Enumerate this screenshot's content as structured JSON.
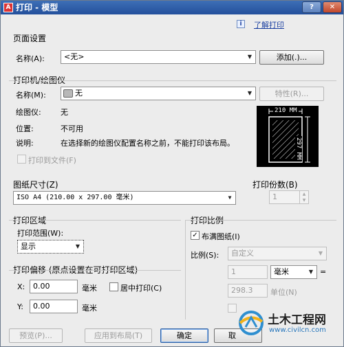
{
  "window": {
    "title": "打印 - 模型"
  },
  "help": {
    "link": "了解打印",
    "icon": "info-icon"
  },
  "page_setup": {
    "group": "页面设置",
    "name_label": "名称(A):",
    "name_value": "<无>",
    "add_button": "添加(.)..."
  },
  "printer": {
    "group": "打印机/绘图仪",
    "name_label": "名称(M):",
    "name_value": "无",
    "properties_button": "特性(R)...",
    "plotter_label": "绘图仪:",
    "plotter_value": "无",
    "location_label": "位置:",
    "location_value": "不可用",
    "desc_label": "说明:",
    "desc_value": "在选择新的绘图仪配置名称之前，不能打印该布局。",
    "print_to_file": "打印到文件(F)",
    "preview_width": "210 MM",
    "preview_height": "297 MM"
  },
  "paper_size": {
    "group": "图纸尺寸(Z)",
    "value": "ISO A4 (210.00 x 297.00 毫米)"
  },
  "copies": {
    "group": "打印份数(B)",
    "value": "1"
  },
  "print_area": {
    "group": "打印区域",
    "range_label": "打印范围(W):",
    "range_value": "显示"
  },
  "print_offset": {
    "group": "打印偏移 (原点设置在可打印区域)",
    "x_label": "X:",
    "x_value": "0.00",
    "x_unit": "毫米",
    "center_label": "居中打印(C)",
    "y_label": "Y:",
    "y_value": "0.00",
    "y_unit": "毫米"
  },
  "print_scale": {
    "group": "打印比例",
    "fit_label": "布满图纸(I)",
    "scale_label": "比例(S):",
    "scale_value": "自定义",
    "num_value": "1",
    "unit_value": "毫米",
    "eq": "=",
    "den_value": "298.3",
    "units_label": "单位(N)"
  },
  "footer": {
    "preview": "预览(P)...",
    "apply": "应用到布局(T)",
    "ok": "确定",
    "cancel": "取"
  },
  "watermark": {
    "brand": "土木工程网",
    "url": "www.civilcn.com"
  }
}
